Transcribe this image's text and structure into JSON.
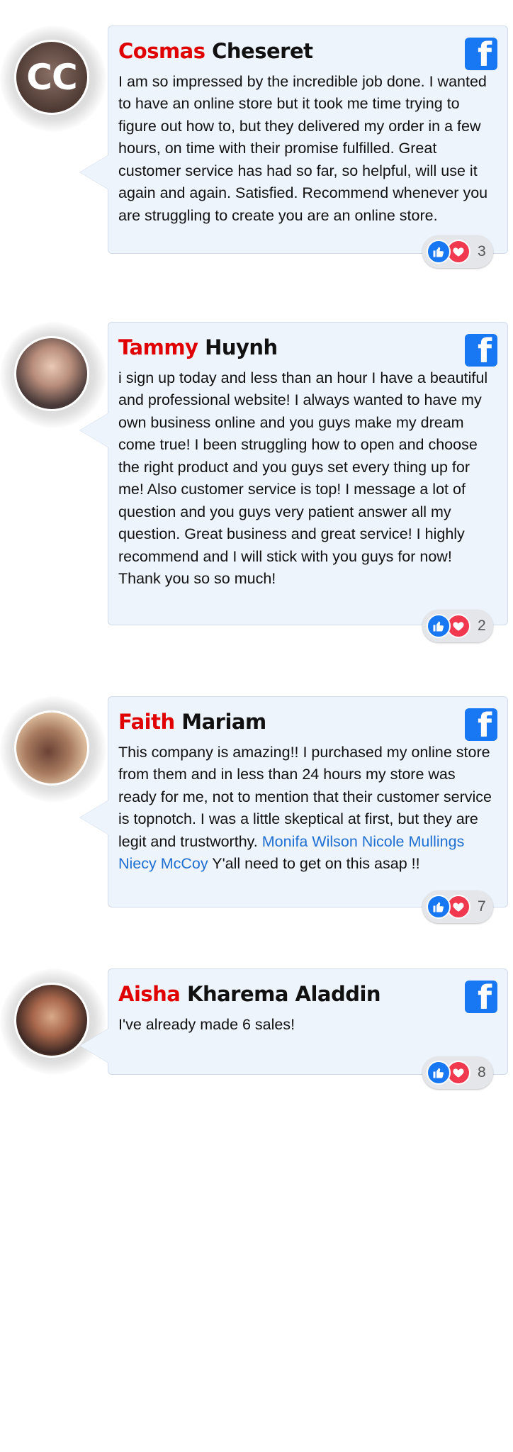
{
  "reviews": [
    {
      "first_name": "Cosmas",
      "last_name": "Cheseret",
      "avatar_initials": "CC",
      "text": "I am so impressed by the incredible job done. I wanted to have an online store but it took me time trying to figure out how to, but they delivered my order in a few hours, on time with their promise fulfilled. Great customer service has had so far, so helpful, will use it again and again. Satisfied. Recommend whenever you are struggling to create you are an online store.",
      "reaction_count": "3"
    },
    {
      "first_name": "Tammy",
      "last_name": "Huynh",
      "text": "i sign up today and less than an hour I have a beautiful and professional website! I always wanted to have my own business online and you guys make my dream come true! I been struggling how to open and choose the right product and you guys set every thing up for me! Also customer service is top! I message a lot of question and you guys very patient answer all my question. Great business and great service! I highly recommend and I will stick with you guys for now! Thank you so so much!",
      "reaction_count": "2"
    },
    {
      "first_name": "Faith",
      "last_name": "Mariam",
      "text": "This company is amazing!! I purchased my online store from them and in less than 24 hours my store was ready for me, not to mention that their customer service is topnotch. I was a little skeptical at first, but they are legit and trustworthy.",
      "mentions": "Monifa Wilson Nicole Mullings Niecy McCoy",
      "text_after": "Y'all need to get on this asap !!",
      "reaction_count": "7"
    },
    {
      "first_name": "Aisha",
      "last_name": "Kharema Aladdin",
      "text": "I've already made 6 sales!",
      "reaction_count": "8"
    }
  ],
  "icons": {
    "facebook_glyph": "f",
    "facebook_color": "#1877f2",
    "like_color": "#1877f2",
    "love_color": "#f0384f"
  },
  "colors": {
    "first_name": "#e00000",
    "mention": "#1f6fd1",
    "bubble_bg": "#edf4fc"
  }
}
